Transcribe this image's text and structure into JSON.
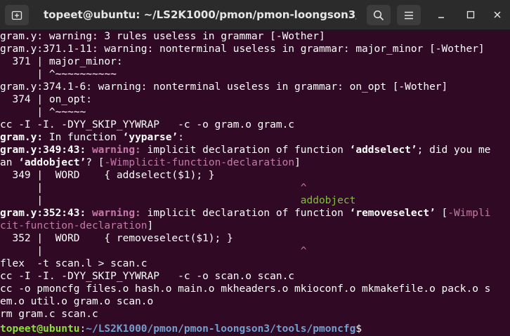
{
  "window": {
    "title": "topeet@ubuntu: ~/LS2K1000/pmon/pmon-loongson3/tools/...",
    "new_tab_icon": "new-tab-icon",
    "search_icon": "search-icon",
    "menu_icon": "hamburger-menu-icon",
    "minimize_icon": "minimize-icon",
    "maximize_icon": "maximize-icon",
    "close_icon": "close-icon"
  },
  "colors": {
    "background": "#300a24",
    "titlebar": "#2b2b2b",
    "warning": "#c678a8",
    "fixit": "#7fbf3f",
    "prompt_user": "#8ae234",
    "prompt_path": "#729fcf"
  },
  "terminal": {
    "l1": "gram.y: warning: 3 rules useless in grammar [-Wother]",
    "l2": "gram.y:371.1-11: warning: nonterminal useless in grammar: major_minor [-Wother]",
    "l3": "  371 | major_minor:",
    "l4": "      | ^~~~~~~~~~~",
    "l5": "gram.y:374.1-6: warning: nonterminal useless in grammar: on_opt [-Wother]",
    "l6": "  374 | on_opt:",
    "l7": "      | ^~~~~~",
    "l8": "cc -I -I. -DYY_SKIP_YYWRAP   -c -o gram.o gram.c",
    "l9a": "gram.y:",
    "l9b": " In function ",
    "l9c": "‘yyparse’",
    "l9d": ":",
    "l10a": "gram.y:349:43:",
    "l10b": " warning:",
    "l10c": " implicit declaration of function ",
    "l10d": "‘addselect’",
    "l10e": "; did you me",
    "l11a": "an ",
    "l11b": "‘addobject’",
    "l11c": "? [",
    "l11d": "-Wimplicit-function-declaration",
    "l11e": "]",
    "l12": "  349 |  WORD    { addselect($1); }",
    "l13a": "      |                                          ",
    "l13b": "^",
    "l14a": "      |                                          ",
    "l14b": "addobject",
    "l15a": "gram.y:352:43:",
    "l15b": " warning:",
    "l15c": " implicit declaration of function ",
    "l15d": "‘removeselect’",
    "l15e": " [",
    "l15f": "-Wimpli",
    "l16a": "cit-function-declaration",
    "l16b": "]",
    "l17": "  352 |  WORD    { removeselect($1); }",
    "l18a": "      |                                          ",
    "l18b": "^",
    "l19": "flex  -t scan.l > scan.c",
    "l20": "cc -I -I. -DYY_SKIP_YYWRAP   -c -o scan.o scan.c",
    "l21": "cc -o pmoncfg files.o hash.o main.o mkheaders.o mkioconf.o mkmakefile.o pack.o s",
    "l22": "em.o util.o gram.o scan.o",
    "l23": "rm gram.c scan.c",
    "prompt_user": "topeet@ubuntu",
    "prompt_sep": ":",
    "prompt_path": "~/LS2K1000/pmon/pmon-loongson3/tools/pmoncfg",
    "prompt_end": "$"
  }
}
